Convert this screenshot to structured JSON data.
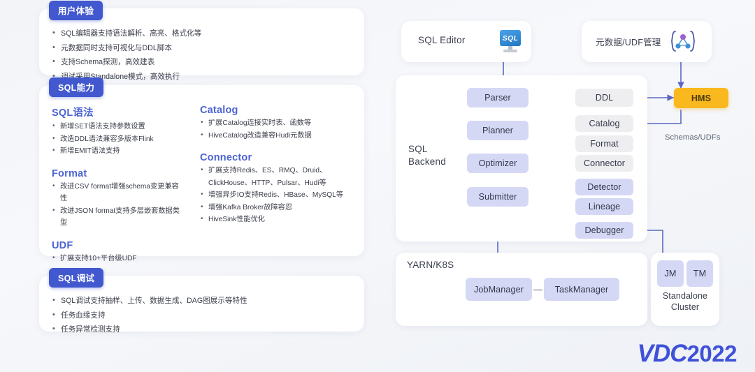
{
  "left": {
    "ux": {
      "badge": "用户体验",
      "bullets": [
        "SQL编辑器支持语法解析、高亮、格式化等",
        "元数据同时支持可视化与DDL脚本",
        "支持Schema探测，高效建表",
        "调试采用Standalone模式，高效执行"
      ]
    },
    "capability": {
      "badge": "SQL能力",
      "sections": [
        {
          "title": "SQL语法",
          "items": [
            "新增SET语法支持参数设置",
            "改造DDL语法兼容多版本Flink",
            "新增EMIT语法支持"
          ]
        },
        {
          "title": "Format",
          "items": [
            "改进CSV format增强schema变更兼容性",
            "改进JSON format支持多层嵌套数据类型"
          ]
        },
        {
          "title": "UDF",
          "items": [
            "扩展支持10+平台级UDF"
          ]
        },
        {
          "title": "Catalog",
          "items": [
            "扩展Catalog连接实时表、函数等",
            "HiveCatalog改造兼容Hudi元数据"
          ]
        },
        {
          "title": "Connector",
          "items": [
            "扩展支持Redis、ES、RMQ、Druid、ClickHouse、HTTP、Pulsar、Hudi等",
            "增强异步IO支持Redis、HBase、MySQL等",
            "增强Kafka Broker故障容忍",
            "HiveSink性能优化"
          ]
        }
      ]
    },
    "debug": {
      "badge": "SQL调试",
      "bullets": [
        "SQL调试支持抽样、上传、数据生成、DAG图展示等特性",
        "任务血缘支持",
        "任务异常检测支持"
      ]
    }
  },
  "diagram": {
    "sql_editor": {
      "label": "SQL Editor",
      "icon": "sql-monitor-icon",
      "icon_text": "SQL"
    },
    "metadata_udf": {
      "label": "元数据/UDF管理",
      "icon": "udf-graph-icon"
    },
    "backend": {
      "label": "SQL\nBackend",
      "label_line1": "SQL",
      "label_line2": "Backend",
      "pipeline": [
        "Parser",
        "Planner",
        "Optimizer",
        "Submitter"
      ],
      "right_grey": [
        "DDL",
        "Catalog",
        "Format",
        "Connector"
      ],
      "right_purple": [
        "Detector",
        "Lineage"
      ],
      "debugger": "Debugger"
    },
    "hms": {
      "label": "HMS",
      "caption": "Schemas/UDFs"
    },
    "yarn": {
      "label": "YARN/K8S",
      "nodes": [
        "JobManager",
        "TaskManager"
      ],
      "link": "—"
    },
    "standalone": {
      "nodes": [
        "JM",
        "TM"
      ],
      "caption_line1": "Standalone",
      "caption_line2": "Cluster"
    }
  },
  "logo": {
    "mark": "VDC",
    "year": "2022"
  },
  "colors": {
    "badge_blue": "#4258CF",
    "heading_blue": "#4C63D2",
    "node_purple": "#D5D8F5",
    "node_grey": "#EEEEF1",
    "hms_orange": "#F9B81E",
    "wire": "#5A67C4",
    "logo_blue": "#3F51D8"
  }
}
